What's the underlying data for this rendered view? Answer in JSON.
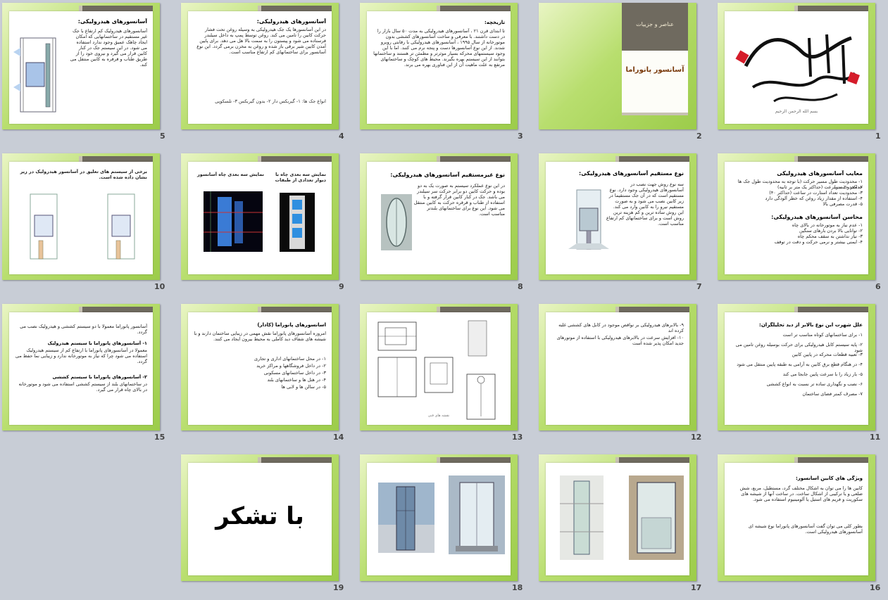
{
  "numbers": [
    "1",
    "2",
    "3",
    "4",
    "5",
    "6",
    "7",
    "8",
    "9",
    "10",
    "11",
    "12",
    "13",
    "14",
    "15",
    "16",
    "17",
    "18",
    "19"
  ],
  "s1": {
    "calligraphy": "بسم الله الرحمن الرحیم"
  },
  "s2": {
    "subtitle": "عناصر و جزییات",
    "title": "آسانسور پانوراما"
  },
  "s3": {
    "heading": "تاریخچه:",
    "body": "تا ابتدای قرن ۲۱ ، آسانسورهای هیدرولیکی به مدت ۵۰ سال بازار را در دست داشتند. با معرفی و ساخت آسانسورهای کششی بدون موتورخانه از سال ۱۹۹۵ ، آسانسورهای هیدرولیکی با رقابتی روبرو شدند. از این نوع آسانسورها دست و پنجه نرم می کنند. اما با این وجود سیستمهای محرکه بسیار موثرتر و مطمئن تر هستند و ساختمانها بتوانند از این سیستم بهره بگیرند. محیط های کوچک و ساختمانهای مرتفع به علت ماهیت آن از این فناوری بهره می برند."
  },
  "s4": {
    "heading": "آسانسورهای هیدرولیکی:",
    "body": "در این آسانسورها یک جک هیدرولیکی به وسیله روغن تحت فشار حرکت کابین را تامین می کند. روغن توسط پمپ به داخل سیلندر فرستاده می شود و پیستون را به سمت بالا هل می دهد. برای پایین آمدن کابین شیر برقی باز شده و روغن به مخزن برمی گردد. این نوع آسانسور برای ساختمانهای کم ارتفاع مناسب است.",
    "note": "انواع جک ها: ۱- گیربکس دار ۲- بدون گیربکس ۳- تلسکوپی"
  },
  "s5": {
    "heading": "آسانسورهای هیدرولیکی:",
    "body": "آسانسورهای هیدرولیک کم ارتفاع با جک غیر مستقیم در ساختمانهایی که امکان ایجاد چاهک عمیق وجود ندارد استفاده می شود. در این سیستم جک در کنار کابین قرار می گیرد و نیروی خود را از طریق طناب و قرقره به کابین منتقل می کند."
  },
  "s6": {
    "heading1": "معایب آسانسورهای هیدرولیکی",
    "items1": [
      "۱- محدودیت طول مسیر حرکت (با توجه به محدودیت طول جک ها حداکثر ۲۰ متر)",
      "۲- محدودیت سرعت (حداکثر یک متر بر ثانیه)",
      "۳- محدودیت تعداد استارت در ساعت (حداکثر ۴۰)",
      "۴- استفاده از مقدار زیاد روغن که خطر آلودگی دارد",
      "۵- قدرت مصرفی بالا"
    ],
    "heading2": "محاسن آسانسورهای هیدرولیکی:",
    "items2": [
      "۱- عدم نیاز به موتورخانه در بالای چاه",
      "۲- توانایی بالا بردن بارهای سنگین",
      "۳- نیاز نداشتن به سقف محکم چاه",
      "۴- ایمنی بیشتر و نرمی حرکت و دقت در توقف"
    ]
  },
  "s7": {
    "heading": "نوع مستقیم آسانسورهای هیدرولیکی:",
    "body": "سه نوع روش جهت نصب در آسانسورهای هیدرولیکی وجود دارد. نوع مستقیم است که در آن جک مستقیما در زیر کابین نصب می شود و به صورت مستقیم نیرو را به کابین وارد می کند. این روش ساده ترین و کم هزینه ترین روش است و برای ساختمانهای کم ارتفاع مناسب است."
  },
  "s8": {
    "heading": "نوع غیرمستقیم آسانسورهای هیدرولیکی:",
    "body": "در این نوع عملکرد سیستم به صورت یک به دو بوده و حرکت کابین دو برابر حرکت سر سیلندر می باشد. جک در کنار کابین قرار گرفته و با استفاده از طناب و قرقره حرکت به کابین منتقل می شود. این نوع برای ساختمانهای بلندتر مناسب است."
  },
  "s9": {
    "caption_left": "نمایش سه بعدی چاه آسانسور",
    "caption_right": "نمایش سه بعدی چاه با دیوار تعدادی از طبقات"
  },
  "s10": {
    "caption": "برخی از سیستم های تعلیق در آسانسور هیدرولیک در زیر نشان داده شده است."
  },
  "s11": {
    "heading": "علل شهرت این نوع بالابر از دید تحلیلگران:",
    "items": [
      "۱- برای ساختمانهای کوتاه مناسب تر است",
      "۲- پایه سیستم کابل هیدرولیکی برای حرکت بوسیله روغن تامین می شود",
      "۳- تعبیه قطعات محرکه در پایین کابین",
      "۴- در هنگام قطع برق کابین به آرامی به طبقه پایین منتقل می شود",
      "۵- بار زیاد را با سرعت پایین جابجا می کند",
      "۶- نصب و نگهداری ساده تر نسبت به انواع کششی",
      "۷- مصرف کمتر فضای ساختمان"
    ]
  },
  "s12": {
    "items": [
      "۹- بالابرهای هیدرولیکی بر نواقص موجود در کابل های کششی غلبه کرده اند",
      "۱۰- افزایش سرعت در بالابرهای هیدرولیکی با استفاده از موتورهای جدید امکان پذیر شده است"
    ]
  },
  "s13": {
    "label": "نقشه های فنی"
  },
  "s14": {
    "heading": "آسانسورهای پانوراما (کادار)",
    "body": "امروزه آسانسورهای پانوراما نقش مهمی در زیبایی ساختمان دارند و با شیشه های شفاف دید کاملی به محیط بیرون ایجاد می کنند.",
    "items": [
      "۱- در محل ساختمانهای اداری و تجاری",
      "۲- در داخل فروشگاهها و مراکز خرید",
      "۳- در داخل ساختمانهای مسکونی",
      "۴- در هتل ها و ساختمانهای بلند",
      "۵- در سالن ها و لابی ها"
    ]
  },
  "s15": {
    "intro": "آسانسور پانوراما معمولا با دو سیستم کششی و هیدرولیک نصب می گردد.",
    "heading1": "۱- آسانسورهای پانوراما با سیستم هیدرولیک",
    "body1": "معمولا در آسانسورهای پانوراما با ارتفاع کم از سیستم هیدرولیک استفاده می شود چرا که نیاز به موتورخانه ندارد و زیبایی نما حفظ می گردد.",
    "heading2": "۲- آسانسورهای پانوراما با سیستم کششی",
    "body2": "در ساختمانهای بلند از سیستم کششی استفاده می شود و موتورخانه در بالای چاه قرار می گیرد."
  },
  "s16": {
    "heading": "ویژگی های کابین آسانسور:",
    "body1": "کابین ها را می توان به اشکال مختلف گرد، مستطیل، مربع، شش ضلعی و یا ترکیبی از اشکال ساخت. در ساخت آنها از شیشه های سکوریت و فریم های استیل یا آلومینیوم استفاده می شود.",
    "body2": "بطور کلی می توان گفت آسانسورهای پانوراما نوع شیشه ای آسانسورهای هیدرولیکی است."
  },
  "s19": {
    "thanks": "با تشکر"
  }
}
